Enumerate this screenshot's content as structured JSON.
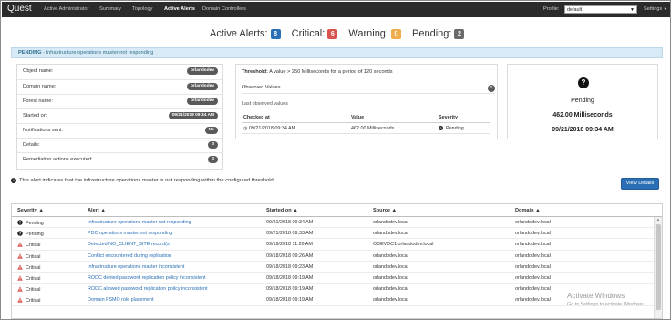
{
  "nav": {
    "logo": "Quest",
    "items": [
      "Active Administrator",
      "Summary",
      "Topology",
      "Active Alerts",
      "Domain Controllers"
    ],
    "active": "Active Alerts",
    "profile_label": "Profile:",
    "profile_value": "default",
    "settings_label": "Settings"
  },
  "counters": {
    "active_label": "Active Alerts:",
    "active_count": "8",
    "critical_label": "Critical:",
    "critical_count": "6",
    "warning_label": "Warning:",
    "warning_count": "0",
    "pending_label": "Pending:",
    "pending_count": "2",
    "colors": {
      "active": "#2a6fb5",
      "critical": "#d9534f",
      "warning": "#f0ad4e",
      "pending": "#6b6b6b"
    }
  },
  "infobar": {
    "status": "PENDING",
    "message": " - Infrastructure operations master not responding"
  },
  "details": [
    {
      "key": "Object name:",
      "value": "orlandodev"
    },
    {
      "key": "Domain name:",
      "value": "orlandodev"
    },
    {
      "key": "Forest name:",
      "value": "orlandodev"
    },
    {
      "key": "Started on:",
      "value": "09/21/2018 09:34 AM"
    },
    {
      "key": "Notifications sent:",
      "value": "No"
    },
    {
      "key": "Details:",
      "value": "0"
    },
    {
      "key": "Remediation actions executed:",
      "value": "0"
    }
  ],
  "threshold": {
    "label": "Threshold:",
    "text": " A value > 250 Milliseconds for a period of 120 seconds",
    "observed_label": "Observed Values",
    "observed_count": "1",
    "last_observed": "Last observed values",
    "columns": [
      "Checked at",
      "Value",
      "Severity"
    ],
    "rows": [
      {
        "checked_at": "09/21/2018 09:34 AM",
        "value": "462.00 Milliseconds",
        "severity": "Pending"
      }
    ]
  },
  "status_card": {
    "state": "Pending",
    "value": "462.00 Milliseconds",
    "time": "09/21/2018 09:34 AM"
  },
  "note": "This alert indicates that the infrastructure operations master is not responding within the configured threshold.",
  "view_details_label": "View Details",
  "grid": {
    "columns": [
      "Severity",
      "Alert",
      "Started on",
      "Source",
      "Domain"
    ],
    "rows": [
      {
        "severity": "Pending",
        "alert": "Infrastructure operations master not responding",
        "started": "09/21/2018 09:34 AM",
        "source": "orlandodev.local",
        "domain": "orlandodev.local"
      },
      {
        "severity": "Pending",
        "alert": "PDC operations master not responding",
        "started": "09/21/2018 09:33 AM",
        "source": "orlandodev.local",
        "domain": "orlandodev.local"
      },
      {
        "severity": "Critical",
        "alert": "Detected NO_CLIENT_SITE record(s)",
        "started": "09/19/2018 11:26 AM",
        "source": "ODEVDC1.orlandodev.local",
        "domain": "orlandodev.local"
      },
      {
        "severity": "Critical",
        "alert": "Conflict encountered during replication",
        "started": "09/18/2018 09:26 AM",
        "source": "orlandodev.local",
        "domain": "orlandodev.local"
      },
      {
        "severity": "Critical",
        "alert": "Infrastructure operations master inconsistent",
        "started": "09/18/2018 09:23 AM",
        "source": "orlandodev.local",
        "domain": "orlandodev.local"
      },
      {
        "severity": "Critical",
        "alert": "RODC denied password replication policy inconsistent",
        "started": "09/18/2018 09:19 AM",
        "source": "orlandodev.local",
        "domain": "orlandodev.local"
      },
      {
        "severity": "Critical",
        "alert": "RODC allowed password replication policy inconsistent",
        "started": "09/18/2018 09:19 AM",
        "source": "orlandodev.local",
        "domain": "orlandodev.local"
      },
      {
        "severity": "Critical",
        "alert": "Domain FSMO role placement",
        "started": "09/18/2018 09:19 AM",
        "source": "orlandodev.local",
        "domain": "orlandodev.local"
      }
    ]
  },
  "watermark": {
    "line1": "Activate Windows",
    "line2": "Go to Settings to activate Windows."
  }
}
